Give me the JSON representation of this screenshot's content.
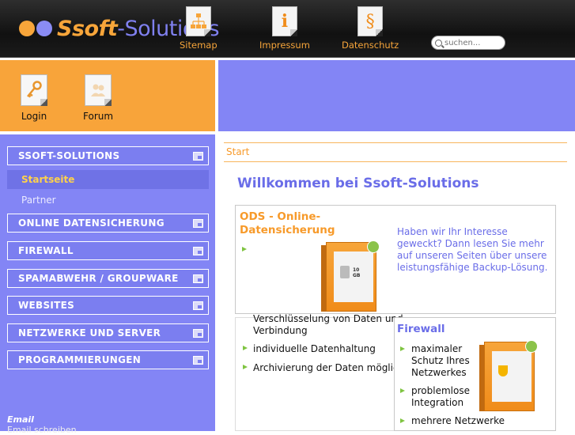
{
  "header": {
    "logo_primary": "Ssoft",
    "logo_secondary": "-Solutions",
    "nav": [
      {
        "label": "Sitemap",
        "icon": "sitemap-icon"
      },
      {
        "label": "Impressum",
        "icon": "info-icon"
      },
      {
        "label": "Datenschutz",
        "icon": "paragraph-icon"
      }
    ],
    "search_placeholder": "suchen..."
  },
  "quick_links": [
    {
      "label": "Login",
      "icon": "key-icon"
    },
    {
      "label": "Forum",
      "icon": "forum-icon"
    }
  ],
  "sidebar": {
    "menu": [
      "SSOFT-SOLUTIONS",
      "ONLINE DATENSICHERUNG",
      "FIREWALL",
      "SPAMABWEHR / GROUPWARE",
      "WEBSITES",
      "NETZWERKE UND SERVER",
      "PROGRAMMIERUNGEN"
    ],
    "submenu": [
      "Startseite",
      "Partner"
    ],
    "email_title": "Email",
    "email_link": "Email schreiben"
  },
  "content": {
    "breadcrumb": "Start",
    "title": "Willkommen bei Ssoft-Solutions",
    "ods": {
      "title_line1": "ODS - Online-",
      "title_line2": "Datensicherung",
      "promo": "Haben wir Ihr Interesse geweckt? Dann lesen Sie mehr auf unseren Seiten über unsere leistungsfähige Backup-Lösung.",
      "box_label": "10 GB",
      "features": [
        "Verschlüsselung von Daten und",
        "Verbindung",
        "individuelle Datenhaltung",
        "Archivierung der Daten möglich"
      ]
    },
    "firewall": {
      "title": "Firewall",
      "features": [
        [
          "maximaler",
          "Schutz Ihres",
          "Netzwerkes"
        ],
        [
          "problemlose",
          "Integration"
        ],
        [
          "mehrere Netzwerke"
        ]
      ]
    }
  },
  "colors": {
    "orange": "#f8a43a",
    "blue": "#8385f5",
    "title_blue": "#6a6de8",
    "bullet_green": "#7fc441"
  }
}
